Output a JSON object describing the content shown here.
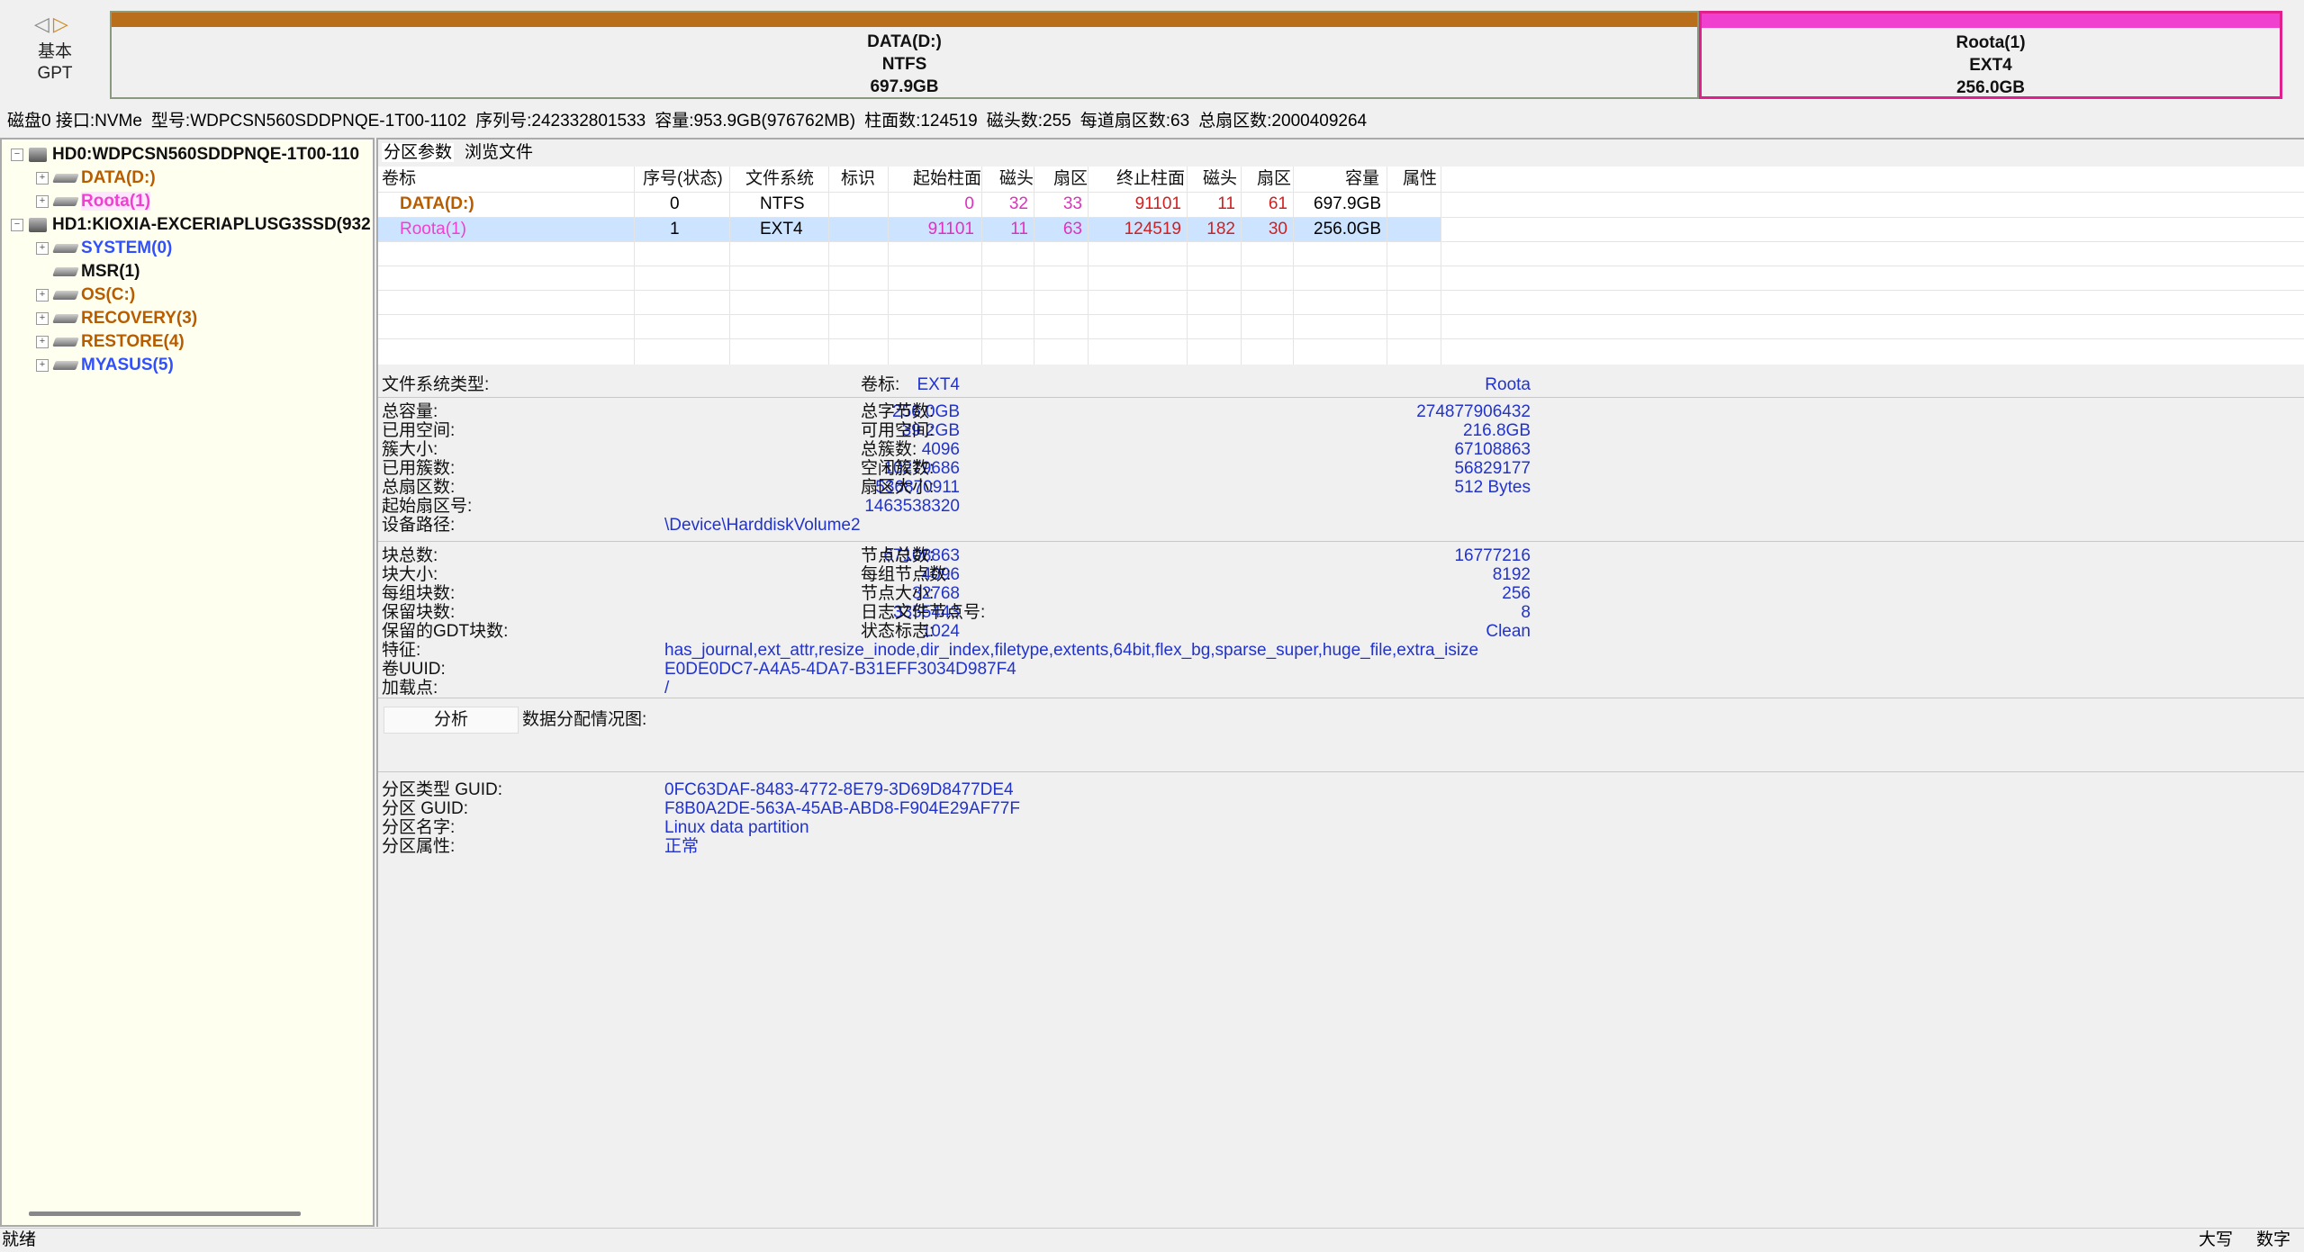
{
  "disk_nav": {
    "prev": "◁",
    "next": "▷",
    "type1": "基本",
    "type2": "GPT"
  },
  "partitions_bar": [
    {
      "name": "DATA(D:)",
      "fs": "NTFS",
      "size": "697.9GB",
      "used_fraction": 0.43
    },
    {
      "name": "Roota(1)",
      "fs": "EXT4",
      "size": "256.0GB",
      "used_fraction": 0.15
    }
  ],
  "disk_info": {
    "disk": "磁盘0 接口:NVMe",
    "model": "型号:WDPCSN560SDDPNQE-1T00-1102",
    "serial": "序列号:242332801533",
    "capacity": "容量:953.9GB(976762MB)",
    "cylinders": "柱面数:124519",
    "heads": "磁头数:255",
    "sectors_per_track": "每道扇区数:63",
    "total_sectors": "总扇区数:2000409264"
  },
  "tree": {
    "hd0": "HD0:WDPCSN560SDDPNQE-1T00-110",
    "hd0_parts": [
      "DATA(D:)",
      "Roota(1)"
    ],
    "hd1": "HD1:KIOXIA-EXCERIAPLUSG3SSD(932",
    "hd1_parts": [
      "SYSTEM(0)",
      "MSR(1)",
      "OS(C:)",
      "RECOVERY(3)",
      "RESTORE(4)",
      "MYASUS(5)"
    ]
  },
  "tabs": [
    "分区参数",
    "浏览文件"
  ],
  "table": {
    "headers": [
      "卷标",
      "序号(状态)",
      "文件系统",
      "标识",
      "起始柱面",
      "磁头",
      "扇区",
      "终止柱面",
      "磁头",
      "扇区",
      "容量",
      "属性"
    ],
    "rows": [
      [
        "DATA(D:)",
        "0",
        "NTFS",
        "",
        "0",
        "32",
        "33",
        "91101",
        "11",
        "61",
        "697.9GB",
        ""
      ],
      [
        "Roota(1)",
        "1",
        "EXT4",
        "",
        "91101",
        "11",
        "63",
        "124519",
        "182",
        "30",
        "256.0GB",
        ""
      ]
    ]
  },
  "fs": {
    "type_label": "文件系统类型:",
    "type_value": "EXT4",
    "vol_label": "卷标:",
    "vol_value": "Roota"
  },
  "stats": {
    "total_cap_l": "总容量:",
    "total_cap_v": "256.0GB",
    "used_l": "已用空间:",
    "used_v": "39.2GB",
    "cluster_l": "簇大小:",
    "cluster_v": "4096",
    "used_clusters_l": "已用簇数:",
    "used_clusters_v": "10279686",
    "total_sectors_l": "总扇区数:",
    "total_sectors_v": "536870911",
    "start_sector_l": "起始扇区号:",
    "start_sector_v": "1463538320",
    "device_path_l": "设备路径:",
    "device_path_v": "\\Device\\HarddiskVolume2",
    "total_bytes_l": "总字节数:",
    "total_bytes_v": "274877906432",
    "free_l": "可用空间:",
    "free_v": "216.8GB",
    "total_clusters_l": "总簇数:",
    "total_clusters_v": "67108863",
    "free_clusters_l": "空闲簇数:",
    "free_clusters_v": "56829177",
    "sector_size_l": "扇区大小:",
    "sector_size_v": "512 Bytes"
  },
  "ext": {
    "blocks_l": "块总数:",
    "blocks_v": "67108863",
    "block_size_l": "块大小:",
    "block_size_v": "4096",
    "blocks_per_group_l": "每组块数:",
    "blocks_per_group_v": "32768",
    "reserved_blocks_l": "保留块数:",
    "reserved_blocks_v": "3355443",
    "reserved_gdt_l": "保留的GDT块数:",
    "reserved_gdt_v": "1024",
    "features_l": "特征:",
    "features_v": "has_journal,ext_attr,resize_inode,dir_index,filetype,extents,64bit,flex_bg,sparse_super,huge_file,extra_isize",
    "uuid_l": "卷UUID:",
    "uuid_v": "E0DE0DC7-A4A5-4DA7-B31EFF3034D987F4",
    "mount_l": "加载点:",
    "mount_v": "/",
    "inodes_l": "节点总数:",
    "inodes_v": "16777216",
    "inodes_per_group_l": "每组节点数:",
    "inodes_per_group_v": "8192",
    "inode_size_l": "节点大小:",
    "inode_size_v": "256",
    "journal_inode_l": "日志文件节点号:",
    "journal_inode_v": "8",
    "state_l": "状态标志:",
    "state_v": "Clean"
  },
  "analyze": {
    "button": "分析",
    "label": "数据分配情况图:"
  },
  "guid": {
    "type_l": "分区类型 GUID:",
    "type_v": "0FC63DAF-8483-4772-8E79-3D69D8477DE4",
    "guid_l": "分区 GUID:",
    "guid_v": "F8B0A2DE-563A-45AB-ABD8-F904E29AF77F",
    "name_l": "分区名字:",
    "name_v": "Linux data partition",
    "attr_l": "分区属性:",
    "attr_v": "正常"
  },
  "status": {
    "text": "就绪",
    "caps": "大写",
    "num": "数字"
  }
}
